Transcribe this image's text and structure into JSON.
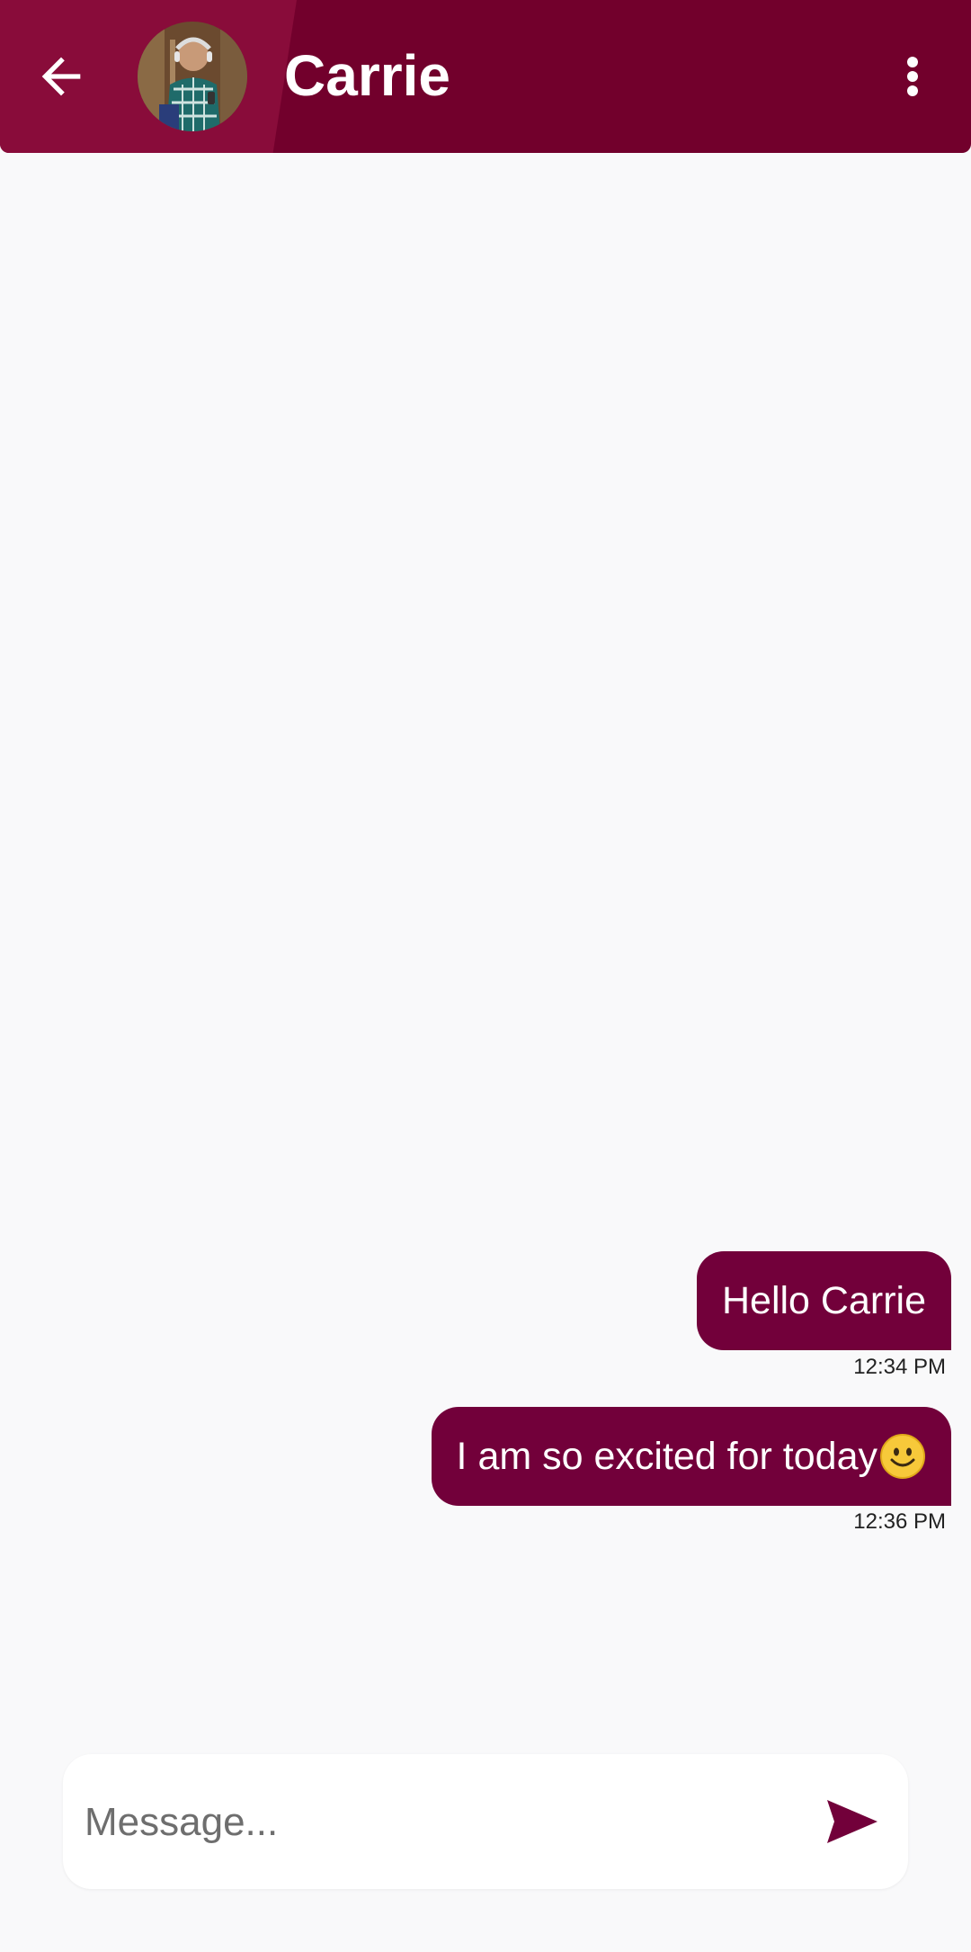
{
  "header": {
    "contact_name": "Carrie",
    "back_icon": "arrow-back-icon",
    "menu_icon": "more-vert-icon",
    "avatar_icon": "contact-avatar"
  },
  "messages": [
    {
      "text": "Hello Carrie",
      "time": "12:34 PM",
      "direction": "outgoing"
    },
    {
      "text": "I am so excited for today",
      "emoji": "smiling-face-icon",
      "time": "12:36 PM",
      "direction": "outgoing"
    }
  ],
  "composer": {
    "placeholder": "Message...",
    "value": "",
    "send_icon": "send-icon"
  },
  "colors": {
    "header": "#72002c",
    "header_accent": "#890c3a",
    "bubble": "#72003a",
    "background": "#f9f9fa",
    "send_icon": "#72003a"
  }
}
